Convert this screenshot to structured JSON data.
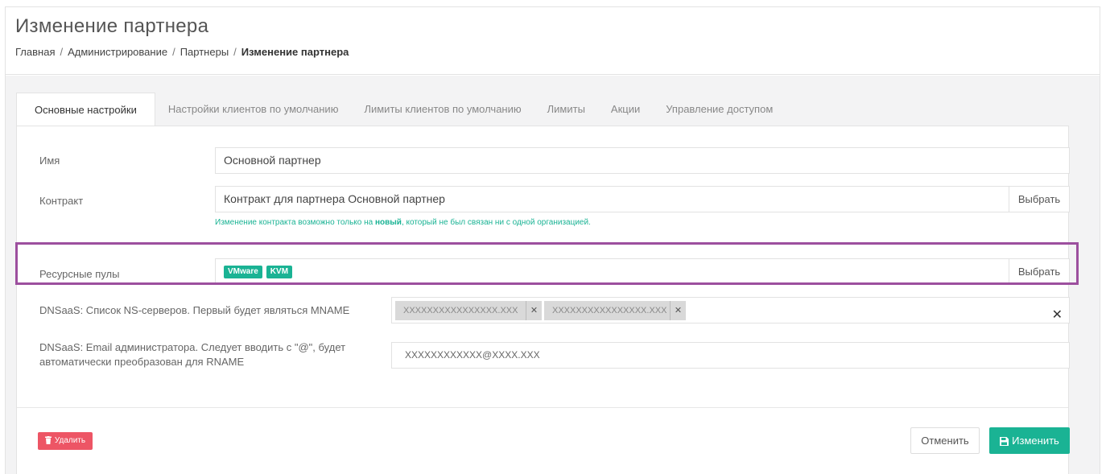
{
  "header": {
    "title": "Изменение партнера",
    "breadcrumb": [
      "Главная",
      "Администрирование",
      "Партнеры",
      "Изменение партнера"
    ],
    "breadcrumb_sep": "/"
  },
  "tabs": [
    "Основные настройки",
    "Настройки клиентов по умолчанию",
    "Лимиты клиентов по умолчанию",
    "Лимиты",
    "Акции",
    "Управление доступом"
  ],
  "form": {
    "name_label": "Имя",
    "name_value": "Основной партнер",
    "contract_label": "Контракт",
    "contract_value": "Контракт для партнера Основной партнер",
    "contract_button": "Выбрать",
    "contract_hint_before": "Изменение контракта возможно только на ",
    "contract_hint_bold": "новый",
    "contract_hint_after": ", который не был связан ни с одной организацией.",
    "pools_label": "Ресурсные пулы",
    "pools_tags": [
      "VMware",
      "KVM"
    ],
    "pools_button": "Выбрать",
    "ns_label": "DNSaaS: Список NS-серверов. Первый будет являться MNAME",
    "ns_values": [
      "XXXXXXXXXXXXXXXX.XXX",
      "XXXXXXXXXXXXXXXX.XXX"
    ],
    "email_label_line1": "DNSaaS: Email администратора. Следует вводить с \"@\", будет",
    "email_label_line2": "автоматически преобразован для RNAME",
    "email_value": "XXXXXXXXXXXX@XXXX.XXX"
  },
  "footer": {
    "delete_label": "Удалить",
    "cancel_label": "Отменить",
    "save_label": "Изменить"
  },
  "colors": {
    "accent": "#1ab394",
    "danger": "#ed5565",
    "highlight": "#9c4f9e"
  }
}
